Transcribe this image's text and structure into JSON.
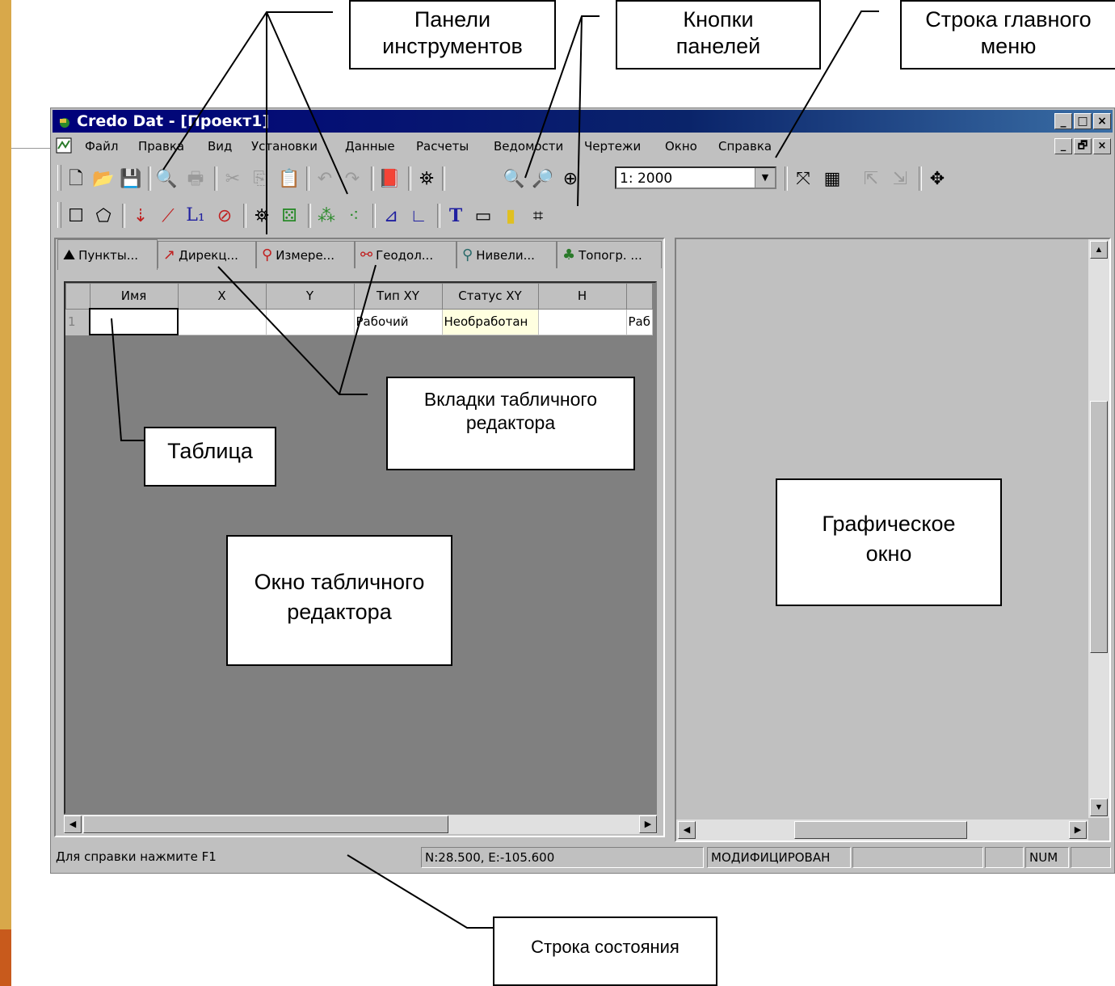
{
  "window": {
    "title": "Credo Dat - [Проект1]",
    "controls": [
      "_",
      "□",
      "×"
    ],
    "mdi_controls": [
      "_",
      "🗗",
      "×"
    ]
  },
  "menu": [
    "Файл",
    "Правка",
    "Вид",
    "Установки",
    "Данные",
    "Расчеты",
    "Ведомости",
    "Чертежи",
    "Окно",
    "Справка"
  ],
  "toolbar": {
    "scale_value": "1: 2000"
  },
  "tabs": [
    "Пункты...",
    "Дирекц...",
    "Измере...",
    "Геодол...",
    "Нивели...",
    "Топогр. ..."
  ],
  "table": {
    "headers": [
      "Имя",
      "X",
      "Y",
      "Тип XY",
      "Статус XY",
      "H",
      ""
    ],
    "row": {
      "num": "1",
      "cells": [
        "",
        "",
        "",
        "Рабочий",
        "Необработан",
        "",
        "Раб"
      ]
    }
  },
  "statusbar": {
    "help": "Для справки нажмите F1",
    "coords": "N:28.500, E:-105.600",
    "state": "МОДИФИЦИРОВАН",
    "num": "NUM"
  },
  "callouts": {
    "toolbars": "Панели\nинструментов",
    "panel_buttons": "Кнопки\nпанелей",
    "main_menu": "Строка главного\nменю",
    "table_tabs": "Вкладки табличного\nредактора",
    "table": "Таблица",
    "table_editor": "Окно табличного\nредактора",
    "graphic_window": "Графическое\nокно",
    "status_line": "Строка состояния"
  },
  "colors": {
    "slide_border": "#d8a84a",
    "title_bar": "#0a246a",
    "window_face": "#c0c0c0"
  }
}
